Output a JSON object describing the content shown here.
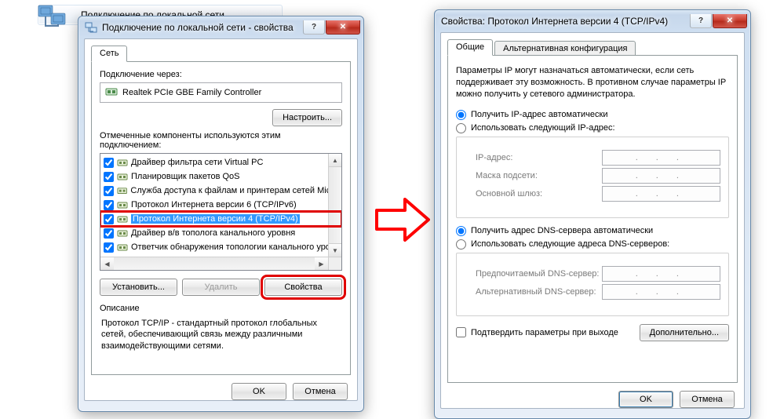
{
  "taskbar": {
    "title": "Подключение по локальной сети"
  },
  "left": {
    "title": "Подключение по локальной сети - свойства",
    "tab_network": "Сеть",
    "connect_via_label": "Подключение через:",
    "adapter_name": "Realtek PCIe GBE Family Controller",
    "configure_btn": "Настроить...",
    "components_label": "Отмеченные компоненты используются этим подключением:",
    "components": [
      {
        "checked": true,
        "text": "Драйвер фильтра сети Virtual PC"
      },
      {
        "checked": true,
        "text": "Планировщик пакетов QoS"
      },
      {
        "checked": true,
        "text": "Служба доступа к файлам и принтерам сетей Micro"
      },
      {
        "checked": true,
        "text": "Протокол Интернета версии 6 (TCP/IPv6)"
      },
      {
        "checked": true,
        "text": "Протокол Интернета версии 4 (TCP/IPv4)",
        "selected": true,
        "highlight": true
      },
      {
        "checked": true,
        "text": "Драйвер в/в тополога канального уровня"
      },
      {
        "checked": true,
        "text": "Ответчик обнаружения топологии канального уро"
      }
    ],
    "btn_install": "Установить...",
    "btn_uninstall": "Удалить",
    "btn_properties": "Свойства",
    "desc_title": "Описание",
    "desc_text": "Протокол TCP/IP - стандартный протокол глобальных сетей, обеспечивающий связь между различными взаимодействующими сетями.",
    "ok": "OK",
    "cancel": "Отмена"
  },
  "right": {
    "title": "Свойства: Протокол Интернета версии 4 (TCP/IPv4)",
    "tab_general": "Общие",
    "tab_alt": "Альтернативная конфигурация",
    "info": "Параметры IP могут назначаться автоматически, если сеть поддерживает эту возможность. В противном случае параметры IP можно получить у сетевого администратора.",
    "ip_auto": "Получить IP-адрес автоматически",
    "ip_manual": "Использовать следующий IP-адрес:",
    "ip_address": "IP-адрес:",
    "subnet": "Маска подсети:",
    "gateway": "Основной шлюз:",
    "dns_auto": "Получить адрес DNS-сервера автоматически",
    "dns_manual": "Использовать следующие адреса DNS-серверов:",
    "dns_pref": "Предпочитаемый DNS-сервер:",
    "dns_alt": "Альтернативный DNS-сервер:",
    "validate": "Подтвердить параметры при выходе",
    "advanced": "Дополнительно...",
    "ok": "OK",
    "cancel": "Отмена"
  }
}
